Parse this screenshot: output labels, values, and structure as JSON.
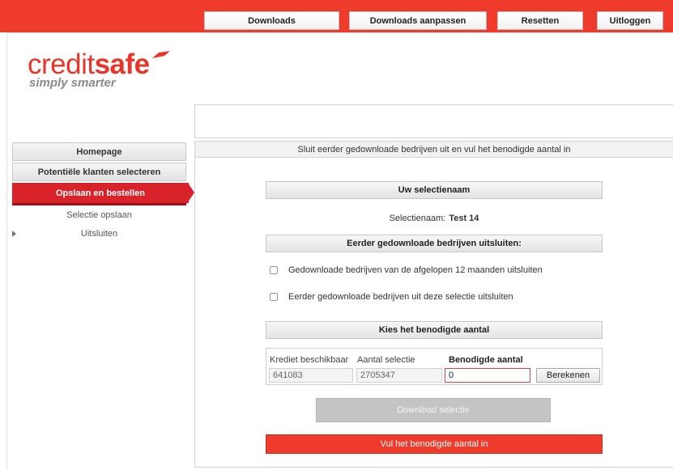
{
  "brand": {
    "logo_part1": "credit",
    "logo_part2": "safe",
    "tagline": "simply smarter",
    "accent_color": "#ee3b2b"
  },
  "toolbar": {
    "downloads": "Downloads",
    "downloads_adjust": "Downloads aanpassen",
    "reset": "Resetten",
    "logout": "Uitloggen"
  },
  "sidebar": {
    "items": [
      {
        "label": "Homepage"
      },
      {
        "label": "Potentiële klanten selecteren"
      },
      {
        "label": "Opslaan en bestellen"
      }
    ],
    "subitems": [
      {
        "label": "Selectie opslaan"
      },
      {
        "label": "Uitsluiten"
      }
    ]
  },
  "main": {
    "header": "Sluit eerder gedownloade bedrijven uit en vul het benodigde aantal in",
    "section_selection_name": "Uw selectienaam",
    "selection_label": "Selectienaam:",
    "selection_value": "Test 14",
    "section_exclude": "Eerder gedownloade bedrijven uitsluiten:",
    "checkbox_1": "Gedownloade bedrijven van de afgelopen 12 maanden uitsluiten",
    "checkbox_2": "Eerder gedownloade bedrijven uit deze selectie uitsluiten",
    "section_amount": "Kies het benodigde aantal",
    "credit_label": "Krediet beschikbaar",
    "credit_value": "641083",
    "count_label": "Aantal selectie",
    "count_value": "2705347",
    "required_label": "Benodigde aantal",
    "required_value": "0",
    "calculate": "Berekenen",
    "download_selection": "Download selectie",
    "error_message": "Vul het benodigde aantal in"
  }
}
